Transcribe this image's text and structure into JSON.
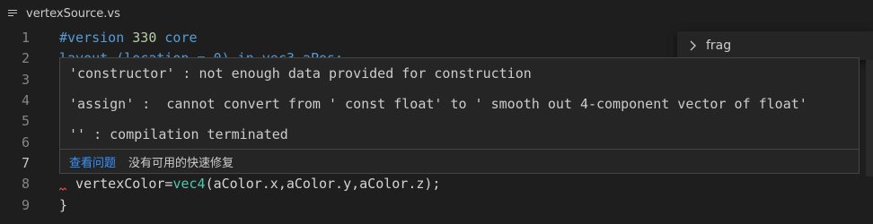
{
  "breadcrumb": {
    "filename": "vertexSource.vs"
  },
  "find_widget": {
    "query": "frag"
  },
  "lines": [
    {
      "num": "1",
      "parts": [
        {
          "t": "#version ",
          "c": "kw"
        },
        {
          "t": "330",
          "c": "num"
        },
        {
          "t": " core",
          "c": "kw"
        }
      ]
    },
    {
      "num": "2",
      "parts": [
        {
          "t": "layout (location = 0) in vec3 aPos;",
          "c": "kw"
        }
      ]
    },
    {
      "num": "3",
      "parts": []
    },
    {
      "num": "4",
      "parts": []
    },
    {
      "num": "5",
      "parts": []
    },
    {
      "num": "6",
      "parts": []
    },
    {
      "num": "7",
      "parts": []
    },
    {
      "num": "8",
      "parts": [
        {
          "t": "  vertexColor=",
          "c": ""
        },
        {
          "t": "vec4",
          "c": "fn"
        },
        {
          "t": "(aColor.x,aColor.y,aColor.z);",
          "c": ""
        }
      ]
    },
    {
      "num": "9",
      "parts": [
        {
          "t": "}",
          "c": ""
        }
      ]
    }
  ],
  "hover": {
    "messages": [
      "'constructor' : not enough data provided for construction",
      "'assign' :  cannot convert from ' const float' to ' smooth out 4-component vector of float'",
      "'' : compilation terminated"
    ],
    "view_problem": "查看问题",
    "no_quick_fix": "没有可用的快速修复"
  },
  "colors": {
    "background": "#1e1e1e",
    "keyword": "#569cd6",
    "number": "#b5cea8",
    "type": "#4ec9b0",
    "link": "#3794ff",
    "error": "#f14c4c"
  }
}
